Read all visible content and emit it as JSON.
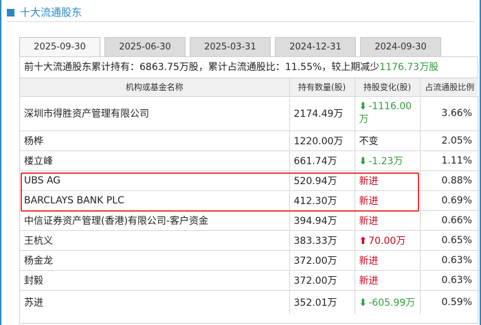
{
  "section": {
    "title": "十大流通股东"
  },
  "tabs": [
    {
      "label": "2025-09-30",
      "active": true
    },
    {
      "label": "2025-06-30",
      "active": false
    },
    {
      "label": "2025-03-31",
      "active": false
    },
    {
      "label": "2024-12-31",
      "active": false
    },
    {
      "label": "2024-09-30",
      "active": false
    }
  ],
  "summary": {
    "prefix": "前十大流通股东累计持有：",
    "total": "6863.75万股",
    "mid": "，累计占流通股比：",
    "ratio": "11.55%",
    "tail": "，较上期减少",
    "change": "1176.73万股"
  },
  "columns": {
    "name": "机构或基金名称",
    "shares": "持有数量(股)",
    "change": "持股变化(股)",
    "ratio": "占流通股比例"
  },
  "rows": [
    {
      "name": "深圳市得胜资产管理有限公司",
      "shares": "2174.49万",
      "arrow": "down",
      "change": "-1116.00万",
      "ratio": "3.66%"
    },
    {
      "name": "杨桦",
      "shares": "1220.00万",
      "arrow": "",
      "change": "不变",
      "ratio": "2.05%"
    },
    {
      "name": "楼立峰",
      "shares": "661.74万",
      "arrow": "down",
      "change": "-1.23万",
      "ratio": "1.11%"
    },
    {
      "name": "UBS AG",
      "shares": "520.94万",
      "arrow": "",
      "change": "新进",
      "ratio": "0.88%"
    },
    {
      "name": "BARCLAYS BANK PLC",
      "shares": "412.30万",
      "arrow": "",
      "change": "新进",
      "ratio": "0.69%"
    },
    {
      "name": "中信证券资产管理(香港)有限公司-客户资金",
      "shares": "394.94万",
      "arrow": "",
      "change": "新进",
      "ratio": "0.66%"
    },
    {
      "name": "王杭义",
      "shares": "383.33万",
      "arrow": "up",
      "change": "70.00万",
      "ratio": "0.65%"
    },
    {
      "name": "杨金龙",
      "shares": "372.00万",
      "arrow": "",
      "change": "新进",
      "ratio": "0.63%"
    },
    {
      "name": "封毅",
      "shares": "372.00万",
      "arrow": "",
      "change": "新进",
      "ratio": "0.63%"
    },
    {
      "name": "苏进",
      "shares": "352.01万",
      "arrow": "down",
      "change": "-605.99万",
      "ratio": "0.59%"
    }
  ],
  "icons": {
    "down": "arrow-down-icon",
    "up": "arrow-up-icon"
  },
  "colors": {
    "accent": "#2a86c8",
    "increase": "#d0021b",
    "decrease": "#2f9e3a",
    "highlight": "#e83a3a"
  }
}
